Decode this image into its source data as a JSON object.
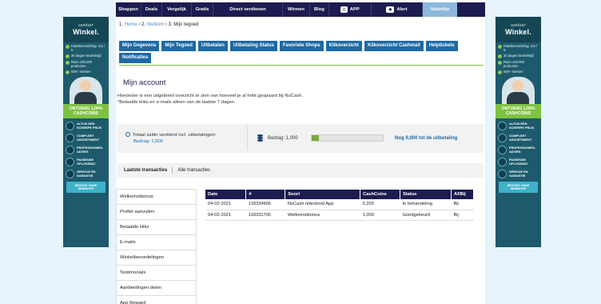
{
  "nav": {
    "items": [
      "Shoppen",
      "Deals",
      "Vergelijk",
      "Gratis",
      "Direct verdienen",
      "Winnen",
      "Blog"
    ],
    "app_label": "APP",
    "alert_label": "Alert",
    "valentijn_label": "Valentijn"
  },
  "breadcrumb": {
    "step1_num": "1.",
    "step1": "Home",
    "step2_num": "2.",
    "step2": "Welkom",
    "step3": "3. Mijn tegoed",
    "sep": "›"
  },
  "tabs": [
    "Mijn Gegevens",
    "Mijn Tegoed",
    "Uitbetalen",
    "Uitbetaling Status",
    "Favoriete Shops",
    "Klikoverzicht",
    "Klikoverzicht Cashmail",
    "Helptickets",
    "Notificaties"
  ],
  "page": {
    "title": "Mijn account",
    "intro1": "Hieronder is een uitgebreid overzicht te zien van hoeveel je al hebt gespaard bij NuCash.",
    "intro2": "*Betaalde kliks en e-mails alleen van de laatste 7 dagen"
  },
  "summary": {
    "total_label": "Totaal saldo verdiend incl. uitbetalingen:",
    "total_amount": "Bedrag: 1,000",
    "bedrag_label": "Bedrag: 1,000",
    "progress_fraction": 0.1,
    "remaining": "Nog 9,000 tot de uitbetaling"
  },
  "subtabs": {
    "latest": "Laatste transacties",
    "all": "Alle transacties"
  },
  "left_menu": [
    "Welkomstbonus",
    "Profiel aanvullen",
    "Betaalde kliks",
    "E-mails",
    "Winkelbeoordelingen",
    "Testimonials",
    "Aanbiedingen delen",
    "App Reward"
  ],
  "table": {
    "headers": [
      "Date",
      "#",
      "Soort",
      "CashCoins",
      "Status",
      "Af/Bij"
    ],
    "rows": [
      [
        "04-02-2021",
        "118334966",
        "NuCash.nlAndroid App",
        "0,200",
        "In behandeling",
        "Bij"
      ],
      [
        "04-02-2021",
        "118331705",
        "Welkomstbonus",
        "1,000",
        "Goedgekeurd",
        "Bij"
      ]
    ]
  },
  "banner": {
    "logo_top": "sanitair",
    "logo": "Winkel.",
    "checks": [
      "Klantbeoordeling: 4,6 / 5",
      "30 dagen bedenktijd",
      "Ruim 100.000 producten",
      "500+ merken"
    ],
    "cashcoins": "ONTVANG 1,00% CASHCOINS",
    "features": [
      "ALTIJD EEN SCHERPE PRIJS",
      "COMPLEET ASSORTIMENT",
      "PROFESSIONEEL ADVIES",
      "PASSENDE OPLOSSING",
      "SERVICE EN GARANTIE"
    ],
    "button": "BEZOEK ONZE WEBSHOP"
  },
  "colors": {
    "nav_bg": "#1c1c50",
    "tab_bg": "#1d6aa6",
    "accent_green": "#7dc242",
    "banner_bg": "#1d5a6b"
  }
}
